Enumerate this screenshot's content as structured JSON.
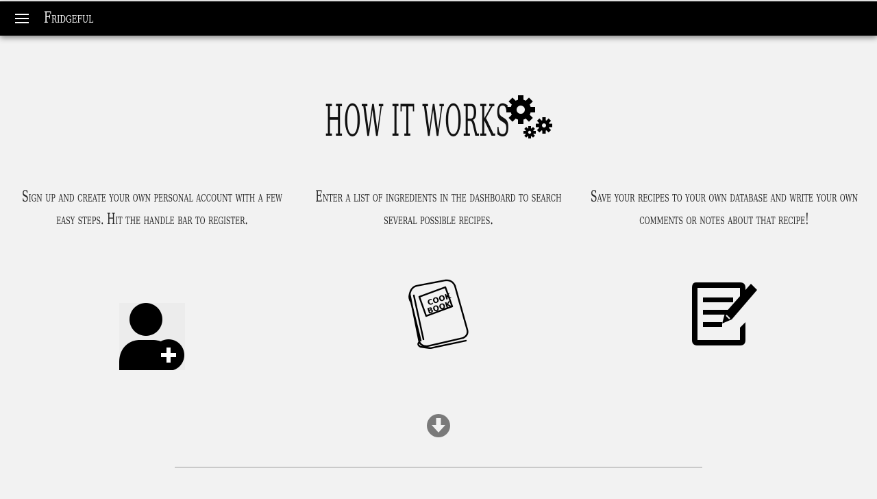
{
  "app": {
    "brand": "Fridgeful"
  },
  "nav": {
    "menu_icon": "hamburger-menu-icon"
  },
  "section": {
    "title": "HOW IT WORKS",
    "title_icon": "gears-icon"
  },
  "steps": [
    {
      "text": "Sign up and create your own personal account with a few easy steps. Hit the handle bar to register.",
      "icon": "user-plus-icon"
    },
    {
      "text": "Enter a list of ingredients in the dashboard to search several possible recipes.",
      "icon": "cookbook-icon"
    },
    {
      "text": "Save your recipes to your own database and write your own comments or notes about that recipe!",
      "icon": "edit-note-icon"
    }
  ],
  "scroll": {
    "icon": "arrow-circle-down-icon"
  },
  "colors": {
    "navbar": "#000000",
    "background": "#f2f2f2",
    "arrow": "#7a7a7a"
  }
}
